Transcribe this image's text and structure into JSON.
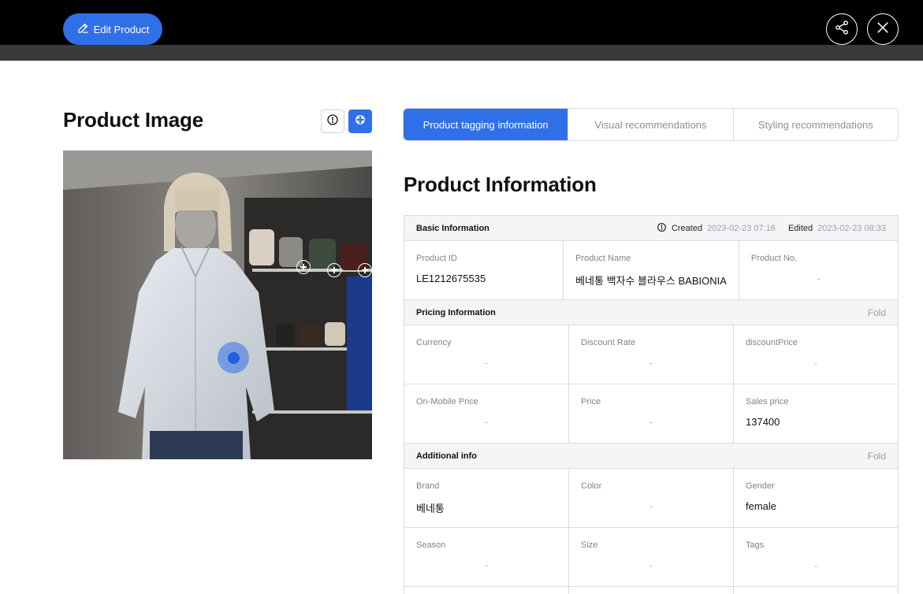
{
  "header": {
    "edit_label": "Edit Product",
    "accent": "#2f6fe8"
  },
  "left": {
    "title": "Product Image"
  },
  "tabs": [
    {
      "label": "Product tagging information",
      "active": true
    },
    {
      "label": "Visual recommendations",
      "active": false
    },
    {
      "label": "Styling recommendations",
      "active": false
    }
  ],
  "info": {
    "title": "Product Information",
    "basic": {
      "title": "Basic Information",
      "created_label": "Created",
      "created_value": "2023-02-23 07:16",
      "edited_label": "Edited",
      "edited_value": "2023-02-23 08:33",
      "fields": [
        {
          "label": "Product ID",
          "value": "LE1212675535"
        },
        {
          "label": "Product Name",
          "value": "베네통 백자수 블라우스 BABIONIA"
        },
        {
          "label": "Product No.",
          "value": "-"
        }
      ]
    },
    "pricing": {
      "title": "Pricing Information",
      "fold": "Fold",
      "rows": [
        [
          {
            "label": "Currency",
            "value": "-"
          },
          {
            "label": "Discount Rate",
            "value": "-"
          },
          {
            "label": "discountPrice",
            "value": "-"
          }
        ],
        [
          {
            "label": "On-Mobile Price",
            "value": "-"
          },
          {
            "label": "Price",
            "value": "-"
          },
          {
            "label": "Sales price",
            "value": "137400"
          }
        ]
      ]
    },
    "additional": {
      "title": "Additional info",
      "fold": "Fold",
      "rows": [
        [
          {
            "label": "Brand",
            "value": "베네통"
          },
          {
            "label": "Color",
            "value": "-"
          },
          {
            "label": "Gender",
            "value": "female"
          }
        ],
        [
          {
            "label": "Season",
            "value": "-"
          },
          {
            "label": "Size",
            "value": "-"
          },
          {
            "label": "Tags",
            "value": "-"
          }
        ]
      ]
    }
  }
}
